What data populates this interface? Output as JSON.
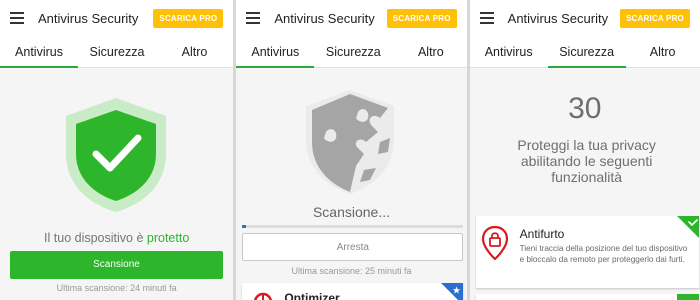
{
  "screens": [
    {
      "header": {
        "title": "Antivirus Security",
        "pro_label": "SCARICA PRO"
      },
      "tabs": [
        "Antivirus",
        "Sicurezza",
        "Altro"
      ],
      "active_tab": 0,
      "status_prefix": "Il tuo dispositivo è ",
      "status_highlight": "protetto",
      "scan_button": "Scansione",
      "last_scan": "Ultima scansione: 24 minuti fa"
    },
    {
      "header": {
        "title": "Antivirus Security",
        "pro_label": "SCARICA PRO"
      },
      "tabs": [
        "Antivirus",
        "Sicurezza",
        "Altro"
      ],
      "active_tab": 0,
      "scanning_text": "Scansione...",
      "stop_button": "Arresta",
      "last_scan": "Ultima scansione: 25 minuti fa",
      "card_title": "Optimizer"
    },
    {
      "header": {
        "title": "Antivirus Security",
        "pro_label": "SCARICA PRO"
      },
      "tabs": [
        "Antivirus",
        "Sicurezza",
        "Altro"
      ],
      "active_tab": 1,
      "count": "30",
      "privacy_text": "Proteggi la tua privacy abilitando le seguenti funzionalità",
      "card": {
        "title": "Antifurto",
        "description": "Tieni traccia della posizione del tuo dispositivo e bloccalo da remoto per proteggerlo dai furti."
      }
    }
  ],
  "colors": {
    "green": "#2db52b",
    "pro_yellow": "#ffc107",
    "tab_indicator": "#2ea83a",
    "red": "#d71a20",
    "blue": "#2d6fd1"
  }
}
